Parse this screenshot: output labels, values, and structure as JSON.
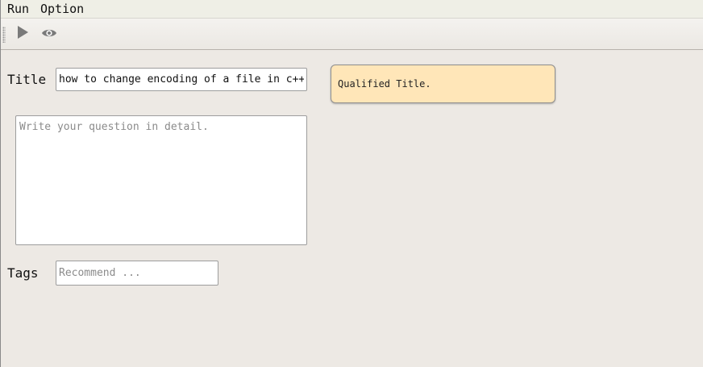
{
  "menubar": {
    "items": [
      {
        "label": "Run"
      },
      {
        "label": "Option"
      }
    ]
  },
  "toolbar": {
    "buttons": [
      {
        "icon": "play-icon"
      },
      {
        "icon": "eye-icon"
      }
    ]
  },
  "form": {
    "title_label": "Title",
    "title_value": "how to change encoding of a file in c++?",
    "detail_placeholder": "Write your question in detail.",
    "tags_label": "Tags",
    "tags_placeholder": "Recommend ..."
  },
  "notice": {
    "text": "Qualified Title.",
    "color": "#ffe6b8"
  },
  "colors": {
    "window_bg": "#ede9e4",
    "icon_gray": "#7a7a7a"
  }
}
